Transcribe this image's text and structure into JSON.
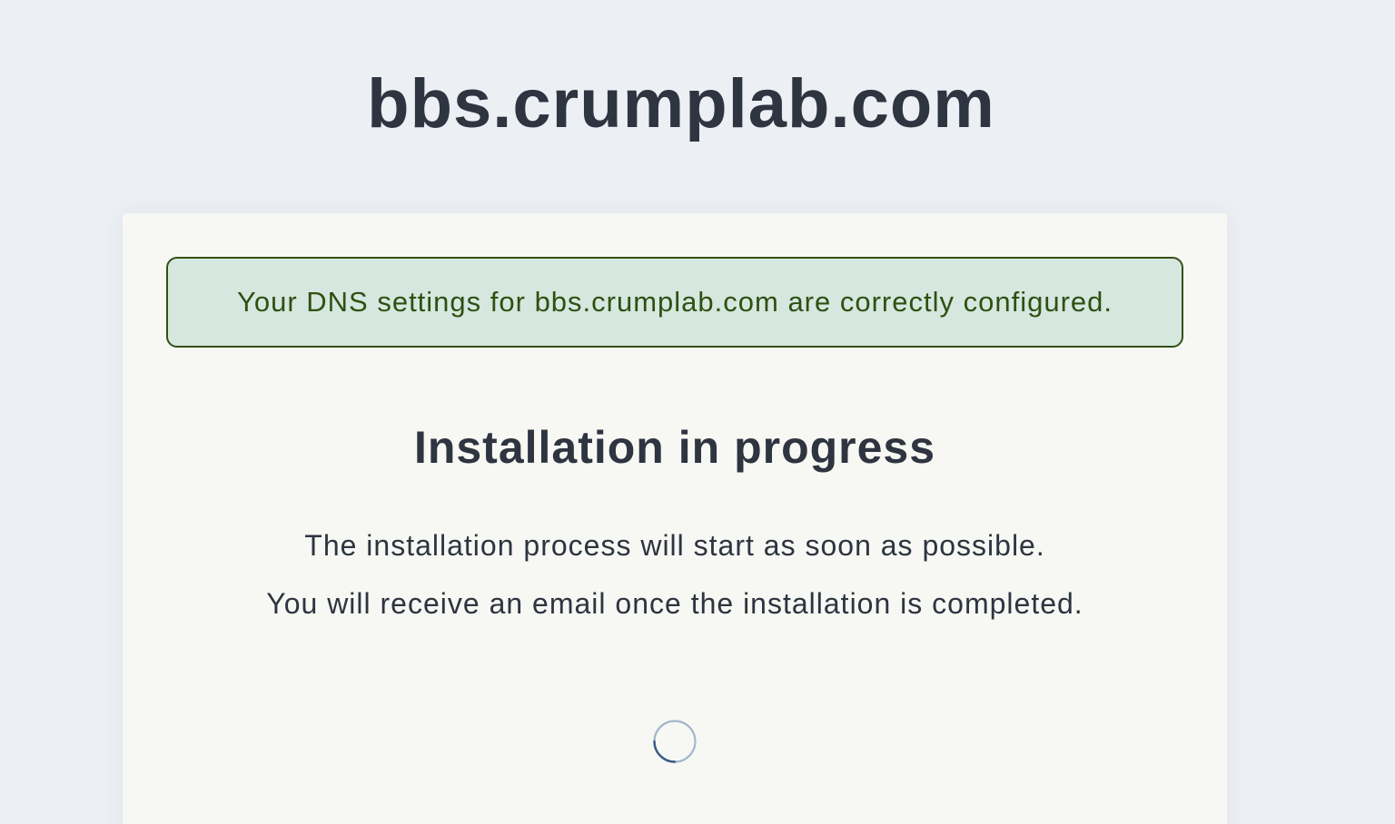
{
  "header": {
    "site_title": "bbs.crumplab.com"
  },
  "alert": {
    "message": "Your DNS settings for bbs.crumplab.com are correctly configured.",
    "status": "success",
    "background_color": "#d6e7df",
    "border_color": "#344f14",
    "text_color": "#2f5012"
  },
  "main": {
    "heading": "Installation in progress",
    "lines": [
      "The installation process will start as soon as possible.",
      "You will receive an email once the installation is completed."
    ],
    "spinner_icon": "loading-spinner-icon"
  },
  "colors": {
    "page_background": "#eceff4",
    "card_background": "#f7f8f3",
    "text": "#2e3440",
    "spinner_track": "#a3b6cc",
    "spinner_arc": "#3b5b85"
  }
}
